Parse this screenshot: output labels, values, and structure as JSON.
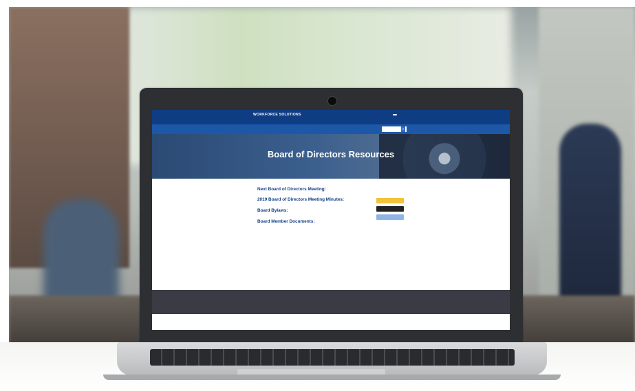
{
  "site": {
    "logo_title": "WORKFORCE SOLUTIONS",
    "logo_sub": "",
    "phone": "",
    "translate": "",
    "nav": [
      "",
      "",
      "",
      "",
      "",
      ""
    ],
    "search_placeholder": "",
    "hero_title": "Board of Directors Resources"
  },
  "content": {
    "next_meeting_heading": "Next Board of Directors Meeting:",
    "next_meeting_text": "",
    "minutes_heading": "2019 Board of Directors Meeting Minutes:",
    "minutes_items": [
      "",
      "",
      "",
      ""
    ],
    "bylaws_heading": "Board Bylaws:",
    "bylaws_items": [
      ""
    ],
    "documents_heading": "Board Member Documents:",
    "documents_items": [
      ""
    ]
  },
  "sidebar": {
    "links_heading": "",
    "links": [
      "",
      "",
      "",
      "",
      "",
      ""
    ],
    "partners_heading": "",
    "partners": [
      "",
      "",
      "",
      ""
    ]
  },
  "footer": {
    "columns": [
      {
        "heading": "",
        "lines": [
          "",
          ""
        ]
      },
      {
        "heading": "",
        "lines": [
          "",
          ""
        ]
      },
      {
        "heading": "",
        "lines": [
          "",
          ""
        ]
      },
      {
        "heading": "",
        "lines": [
          "",
          ""
        ]
      },
      {
        "heading": "",
        "lines": [
          "",
          ""
        ]
      },
      {
        "heading": "",
        "lines": [
          "",
          ""
        ]
      }
    ]
  },
  "colors": {
    "topbar": "#0f3d84",
    "navbar": "#1d58a8",
    "heading": "#0f3d84",
    "link_red": "#c0332b",
    "footer": "#3a3b45"
  }
}
